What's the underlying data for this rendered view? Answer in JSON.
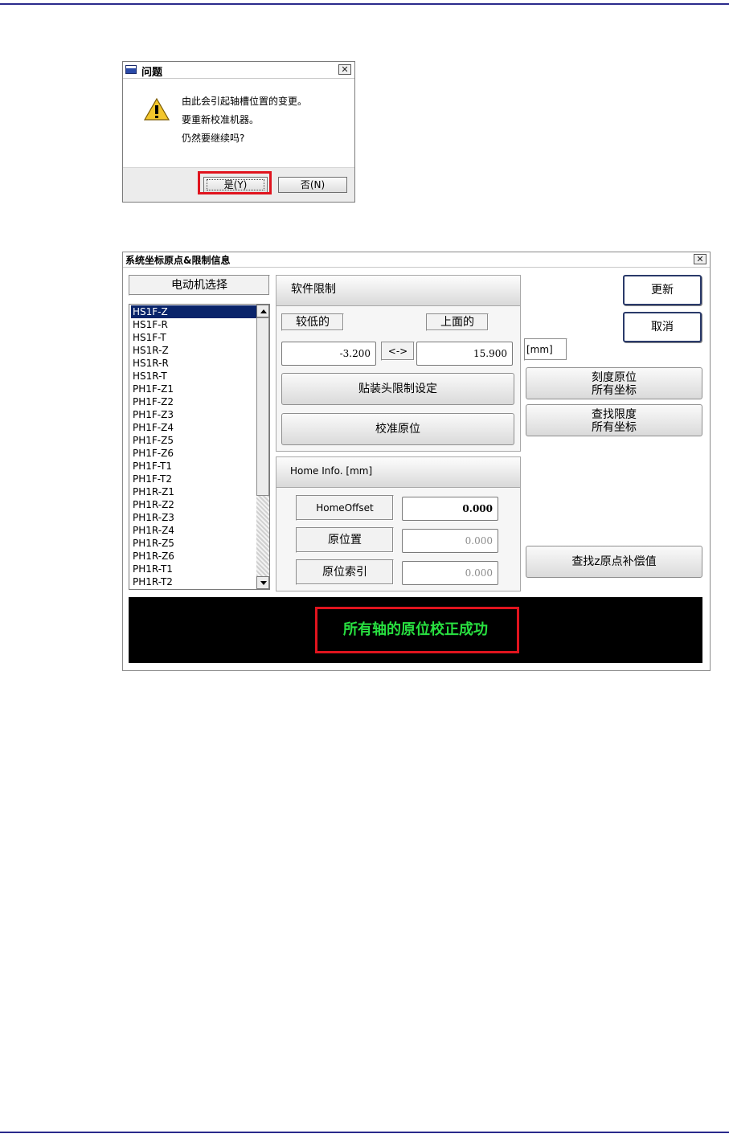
{
  "dialog_question": {
    "title": "问题",
    "message_lines": [
      "由此会引起轴槽位置的变更。",
      "要重新校准机器。",
      "仍然要继续吗?"
    ],
    "yes_label": "是(Y)",
    "no_label": "否(N)",
    "icon": "warning-icon",
    "highlight_color": "#e0141e"
  },
  "dialog_main": {
    "title": "系统坐标原点&限制信息",
    "motor_select_label": "电动机选择",
    "motors": [
      "HS1F-Z",
      "HS1F-R",
      "HS1F-T",
      "HS1R-Z",
      "HS1R-R",
      "HS1R-T",
      "PH1F-Z1",
      "PH1F-Z2",
      "PH1F-Z3",
      "PH1F-Z4",
      "PH1F-Z5",
      "PH1F-Z6",
      "PH1F-T1",
      "PH1F-T2",
      "PH1R-Z1",
      "PH1R-Z2",
      "PH1R-Z3",
      "PH1R-Z4",
      "PH1R-Z5",
      "PH1R-Z6",
      "PH1R-T1",
      "PH1R-T2"
    ],
    "selected_motor": "HS1F-Z",
    "software_limit": {
      "title": "软件限制",
      "lower_label": "较低的",
      "upper_label": "上面的",
      "lower_value": "-3.200",
      "upper_value": "15.900",
      "arrow": "<->",
      "head_limit_button": "贴装头限制设定",
      "calibrate_button": "校准原位"
    },
    "unit": "[mm]",
    "home_info": {
      "title": "Home Info. [mm]",
      "offset_label": "HomeOffset",
      "offset_value": "0.000",
      "position_label": "原位置",
      "position_value": "0.000",
      "index_label": "原位索引",
      "index_value": "0.000"
    },
    "update_button": "更新",
    "cancel_button": "取消",
    "scale_home_button": [
      "刻度原位",
      "所有坐标"
    ],
    "find_limit_button": [
      "查找限度",
      "所有坐标"
    ],
    "find_z_button": "查找z原点补偿值",
    "status_text": "所有轴的原位校正成功",
    "status_color": "#28e040"
  }
}
